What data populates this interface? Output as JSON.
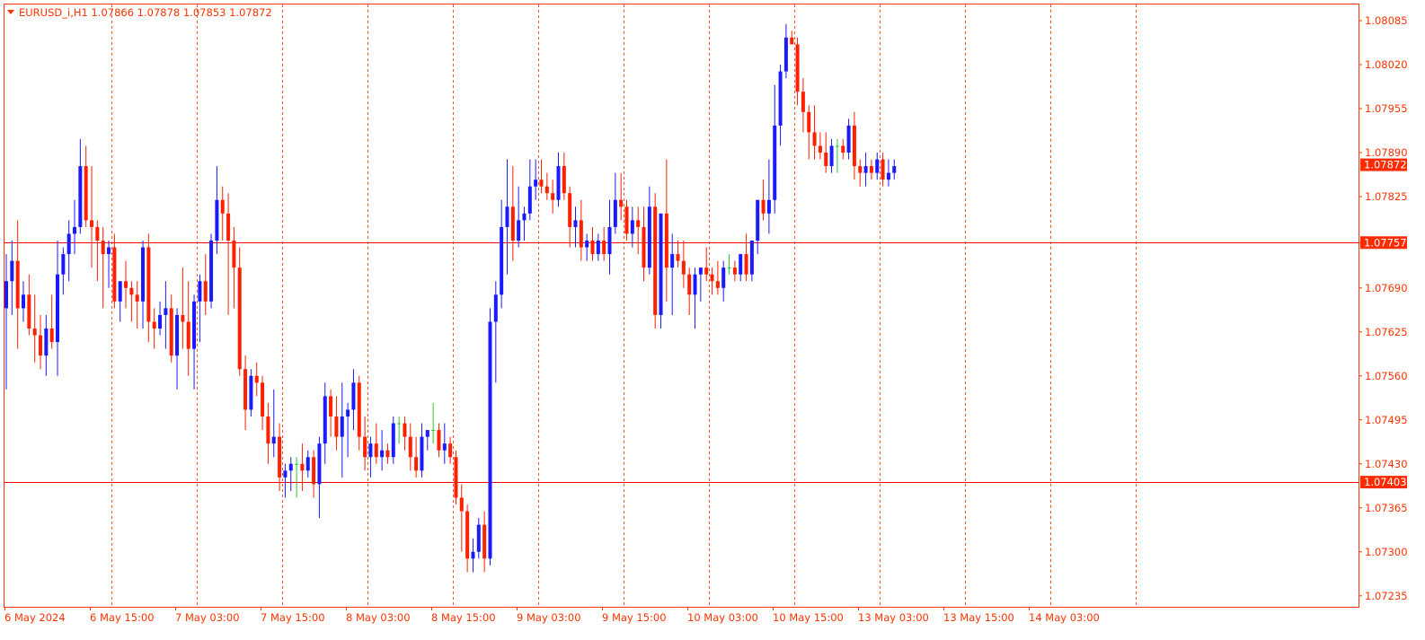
{
  "header": {
    "symbol_line": "EURUSD_i,H1  1.07866 1.07878 1.07853 1.07872",
    "dropdown_icon": "triangle-down-icon"
  },
  "colors": {
    "frame": "#ff3300",
    "text": "#ff3300",
    "bull": "#1a1aff",
    "bear": "#ff2000",
    "doji": "#22cc22",
    "hline": "#ff0000",
    "price_tag_bg": "#ff2a00",
    "price_tag_text": "#ffffff",
    "grid": "#ff3300"
  },
  "chart_data": {
    "type": "candlestick",
    "title": "EURUSD_i,H1",
    "ohlc_readout": {
      "open": 1.07866,
      "high": 1.07878,
      "low": 1.07853,
      "close": 1.07872
    },
    "y_axis": {
      "ticks": [
        "1.08085",
        "1.08020",
        "1.07955",
        "1.07890",
        "1.07825",
        "1.07757",
        "1.07690",
        "1.07625",
        "1.07560",
        "1.07495",
        "1.07430",
        "1.07365",
        "1.07300",
        "1.07235"
      ],
      "range": [
        1.072,
        1.0812
      ]
    },
    "x_axis": {
      "labels": [
        "6 May 2024",
        "6 May 15:00",
        "7 May 03:00",
        "7 May 15:00",
        "8 May 03:00",
        "8 May 15:00",
        "9 May 03:00",
        "9 May 15:00",
        "10 May 03:00",
        "10 May 15:00",
        "13 May 03:00",
        "13 May 15:00",
        "14 May 03:00"
      ]
    },
    "grid": "vertical dashed",
    "horizontal_lines": [
      {
        "price": 1.07757,
        "label": "1.07757"
      },
      {
        "price": 1.07403,
        "label": "1.07403"
      }
    ],
    "current_price": {
      "price": 1.07872,
      "label": "1.07872"
    },
    "candles": [
      [
        1.0766,
        1.0774,
        1.0754,
        1.077
      ],
      [
        1.077,
        1.0776,
        1.0765,
        1.0773
      ],
      [
        1.0773,
        1.0779,
        1.076,
        1.0766
      ],
      [
        1.0766,
        1.077,
        1.0764,
        1.0768
      ],
      [
        1.0768,
        1.0771,
        1.0762,
        1.0763
      ],
      [
        1.0763,
        1.0768,
        1.0758,
        1.0762
      ],
      [
        1.0762,
        1.0765,
        1.0757,
        1.0759
      ],
      [
        1.0759,
        1.0765,
        1.0756,
        1.0763
      ],
      [
        1.0763,
        1.0768,
        1.076,
        1.0761
      ],
      [
        1.0761,
        1.0776,
        1.0756,
        1.0771
      ],
      [
        1.0771,
        1.0775,
        1.0768,
        1.0774
      ],
      [
        1.0774,
        1.0779,
        1.077,
        1.0777
      ],
      [
        1.0777,
        1.0782,
        1.0774,
        1.0778
      ],
      [
        1.0778,
        1.0791,
        1.0777,
        1.0787
      ],
      [
        1.0787,
        1.079,
        1.0778,
        1.0779
      ],
      [
        1.0779,
        1.0787,
        1.0772,
        1.0778
      ],
      [
        1.0778,
        1.0779,
        1.077,
        1.0776
      ],
      [
        1.0776,
        1.0778,
        1.0766,
        1.0774
      ],
      [
        1.0774,
        1.0776,
        1.0769,
        1.0775
      ],
      [
        1.0775,
        1.0777,
        1.0766,
        1.0767
      ],
      [
        1.0767,
        1.0768,
        1.0764,
        1.077
      ],
      [
        1.077,
        1.0773,
        1.0766,
        1.0769
      ],
      [
        1.0769,
        1.077,
        1.0764,
        1.0768
      ],
      [
        1.0768,
        1.077,
        1.0763,
        1.0767
      ],
      [
        1.0767,
        1.0776,
        1.0763,
        1.0775
      ],
      [
        1.0775,
        1.0777,
        1.0761,
        1.0764
      ],
      [
        1.0764,
        1.0766,
        1.076,
        1.0763
      ],
      [
        1.0763,
        1.0767,
        1.0762,
        1.0765
      ],
      [
        1.0765,
        1.077,
        1.076,
        1.0766
      ],
      [
        1.0766,
        1.0768,
        1.0758,
        1.0759
      ],
      [
        1.0759,
        1.0766,
        1.0754,
        1.0765
      ],
      [
        1.0765,
        1.0772,
        1.076,
        1.0764
      ],
      [
        1.0764,
        1.077,
        1.0756,
        1.076
      ],
      [
        1.076,
        1.0768,
        1.0754,
        1.0767
      ],
      [
        1.0767,
        1.0771,
        1.0761,
        1.077
      ],
      [
        1.077,
        1.0774,
        1.0765,
        1.0767
      ],
      [
        1.0767,
        1.0777,
        1.0766,
        1.0776
      ],
      [
        1.0776,
        1.0787,
        1.0774,
        1.0782
      ],
      [
        1.0782,
        1.0784,
        1.0776,
        1.078
      ],
      [
        1.078,
        1.0783,
        1.0765,
        1.0776
      ],
      [
        1.0776,
        1.0778,
        1.0766,
        1.0772
      ],
      [
        1.0772,
        1.0775,
        1.0756,
        1.0757
      ],
      [
        1.0757,
        1.0759,
        1.0748,
        1.0751
      ],
      [
        1.0751,
        1.0757,
        1.075,
        1.0756
      ],
      [
        1.0756,
        1.0758,
        1.0753,
        1.0755
      ],
      [
        1.0755,
        1.0756,
        1.0748,
        1.075
      ],
      [
        1.075,
        1.0752,
        1.0743,
        1.0746
      ],
      [
        1.0746,
        1.0754,
        1.0744,
        1.0747
      ],
      [
        1.0747,
        1.0749,
        1.0739,
        1.0741
      ],
      [
        1.0741,
        1.0743,
        1.0738,
        1.0742
      ],
      [
        1.0742,
        1.0744,
        1.0739,
        1.0743
      ],
      [
        1.0743,
        1.0744,
        1.0738,
        1.0743
      ],
      [
        1.0743,
        1.0746,
        1.0739,
        1.0742
      ],
      [
        1.0742,
        1.0745,
        1.0741,
        1.0744
      ],
      [
        1.0744,
        1.0745,
        1.0738,
        1.074
      ],
      [
        1.074,
        1.0747,
        1.0735,
        1.0746
      ],
      [
        1.0746,
        1.0755,
        1.0743,
        1.0753
      ],
      [
        1.0753,
        1.0754,
        1.0747,
        1.075
      ],
      [
        1.075,
        1.0753,
        1.0745,
        1.0747
      ],
      [
        1.0747,
        1.0755,
        1.0741,
        1.075
      ],
      [
        1.075,
        1.0752,
        1.0744,
        1.0751
      ],
      [
        1.0751,
        1.0757,
        1.0748,
        1.0755
      ],
      [
        1.0755,
        1.0756,
        1.0745,
        1.0747
      ],
      [
        1.0747,
        1.075,
        1.0742,
        1.0744
      ],
      [
        1.0744,
        1.0747,
        1.0741,
        1.0746
      ],
      [
        1.0746,
        1.0749,
        1.0743,
        1.0744
      ],
      [
        1.0744,
        1.0748,
        1.0742,
        1.0745
      ],
      [
        1.0745,
        1.0746,
        1.0743,
        1.0744
      ],
      [
        1.0744,
        1.075,
        1.0743,
        1.0749
      ],
      [
        1.0749,
        1.075,
        1.0746,
        1.0749
      ],
      [
        1.0749,
        1.075,
        1.0745,
        1.0747
      ],
      [
        1.0747,
        1.0749,
        1.0742,
        1.0744
      ],
      [
        1.0744,
        1.0747,
        1.0741,
        1.0742
      ],
      [
        1.0742,
        1.0749,
        1.0741,
        1.0747
      ],
      [
        1.0747,
        1.0748,
        1.0745,
        1.0748
      ],
      [
        1.0748,
        1.0752,
        1.0746,
        1.0748
      ],
      [
        1.0748,
        1.0749,
        1.0744,
        1.0745
      ],
      [
        1.0745,
        1.0749,
        1.0743,
        1.0746
      ],
      [
        1.0746,
        1.0747,
        1.0743,
        1.0744
      ],
      [
        1.0744,
        1.0745,
        1.0737,
        1.0738
      ],
      [
        1.0738,
        1.074,
        1.073,
        1.0736
      ],
      [
        1.0736,
        1.0737,
        1.0727,
        1.0729
      ],
      [
        1.0729,
        1.0732,
        1.0727,
        1.073
      ],
      [
        1.073,
        1.0735,
        1.0729,
        1.0734
      ],
      [
        1.0734,
        1.0736,
        1.0727,
        1.0729
      ],
      [
        1.0729,
        1.0766,
        1.0728,
        1.0764
      ],
      [
        1.0764,
        1.077,
        1.0755,
        1.0768
      ],
      [
        1.0768,
        1.0782,
        1.0766,
        1.0778
      ],
      [
        1.0778,
        1.0788,
        1.0771,
        1.0781
      ],
      [
        1.0781,
        1.0787,
        1.0773,
        1.0776
      ],
      [
        1.0776,
        1.0784,
        1.0775,
        1.0779
      ],
      [
        1.0779,
        1.0781,
        1.0776,
        1.078
      ],
      [
        1.078,
        1.0788,
        1.0779,
        1.0784
      ],
      [
        1.0784,
        1.0788,
        1.0782,
        1.0785
      ],
      [
        1.0785,
        1.0788,
        1.0783,
        1.0784
      ],
      [
        1.0784,
        1.0786,
        1.0782,
        1.0783
      ],
      [
        1.0783,
        1.0785,
        1.078,
        1.0782
      ],
      [
        1.0782,
        1.0789,
        1.0781,
        1.0787
      ],
      [
        1.0787,
        1.0789,
        1.0782,
        1.0783
      ],
      [
        1.0783,
        1.0784,
        1.0775,
        1.0778
      ],
      [
        1.0778,
        1.0781,
        1.0775,
        1.0779
      ],
      [
        1.0779,
        1.0782,
        1.0773,
        1.0775
      ],
      [
        1.0775,
        1.0777,
        1.0773,
        1.0776
      ],
      [
        1.0776,
        1.0778,
        1.0773,
        1.0774
      ],
      [
        1.0774,
        1.0777,
        1.0773,
        1.0776
      ],
      [
        1.0776,
        1.0778,
        1.0773,
        1.0774
      ],
      [
        1.0774,
        1.0782,
        1.0771,
        1.0778
      ],
      [
        1.0778,
        1.0786,
        1.0777,
        1.0782
      ],
      [
        1.0782,
        1.0786,
        1.0779,
        1.0781
      ],
      [
        1.0781,
        1.0782,
        1.0776,
        1.0777
      ],
      [
        1.0777,
        1.0781,
        1.0775,
        1.0779
      ],
      [
        1.0779,
        1.0781,
        1.0774,
        1.0778
      ],
      [
        1.0778,
        1.0781,
        1.077,
        1.0772
      ],
      [
        1.0772,
        1.0784,
        1.0771,
        1.0781
      ],
      [
        1.0781,
        1.0783,
        1.0763,
        1.0765
      ],
      [
        1.0765,
        1.078,
        1.0763,
        1.078
      ],
      [
        1.078,
        1.0788,
        1.0767,
        1.0772
      ],
      [
        1.0772,
        1.0777,
        1.0765,
        1.0774
      ],
      [
        1.0774,
        1.0776,
        1.0772,
        1.0773
      ],
      [
        1.0773,
        1.0776,
        1.0769,
        1.0771
      ],
      [
        1.0771,
        1.0772,
        1.0765,
        1.0768
      ],
      [
        1.0768,
        1.0772,
        1.0763,
        1.0771
      ],
      [
        1.0771,
        1.0772,
        1.0767,
        1.0772
      ],
      [
        1.0772,
        1.0775,
        1.077,
        1.0771
      ],
      [
        1.0771,
        1.0772,
        1.0768,
        1.077
      ],
      [
        1.077,
        1.0773,
        1.0768,
        1.0769
      ],
      [
        1.0769,
        1.0773,
        1.0767,
        1.0772
      ],
      [
        1.0772,
        1.0774,
        1.0771,
        1.0772
      ],
      [
        1.0772,
        1.0773,
        1.077,
        1.0771
      ],
      [
        1.0771,
        1.0774,
        1.077,
        1.0774
      ],
      [
        1.0774,
        1.0777,
        1.077,
        1.0771
      ],
      [
        1.0771,
        1.0776,
        1.077,
        1.0776
      ],
      [
        1.0776,
        1.0782,
        1.0774,
        1.0782
      ],
      [
        1.0782,
        1.0785,
        1.0779,
        1.078
      ],
      [
        1.078,
        1.0788,
        1.0777,
        1.0782
      ],
      [
        1.0782,
        1.0799,
        1.078,
        1.0793
      ],
      [
        1.0793,
        1.0802,
        1.079,
        1.0801
      ],
      [
        1.0801,
        1.0808,
        1.08,
        1.0806
      ],
      [
        1.0806,
        1.0807,
        1.0805,
        1.0805
      ],
      [
        1.0805,
        1.0806,
        1.0796,
        1.0798
      ],
      [
        1.0798,
        1.08,
        1.0792,
        1.0795
      ],
      [
        1.0795,
        1.0796,
        1.0788,
        1.0792
      ],
      [
        1.0792,
        1.0796,
        1.0788,
        1.079
      ],
      [
        1.079,
        1.0792,
        1.0788,
        1.0789
      ],
      [
        1.0789,
        1.0792,
        1.0786,
        1.0787
      ],
      [
        1.0787,
        1.0791,
        1.0786,
        1.079
      ],
      [
        1.079,
        1.0791,
        1.0786,
        1.079
      ],
      [
        1.079,
        1.0791,
        1.0788,
        1.0789
      ],
      [
        1.0789,
        1.0794,
        1.0788,
        1.0793
      ],
      [
        1.0793,
        1.0795,
        1.0785,
        1.0787
      ],
      [
        1.0787,
        1.0788,
        1.0784,
        1.0786
      ],
      [
        1.0786,
        1.0789,
        1.0784,
        1.0787
      ],
      [
        1.0787,
        1.0788,
        1.0785,
        1.0786
      ],
      [
        1.0786,
        1.0789,
        1.0785,
        1.0788
      ],
      [
        1.0788,
        1.0789,
        1.0784,
        1.0785
      ],
      [
        1.0785,
        1.0788,
        1.0784,
        1.0786
      ],
      [
        1.0786,
        1.0788,
        1.0785,
        1.0787
      ]
    ]
  }
}
